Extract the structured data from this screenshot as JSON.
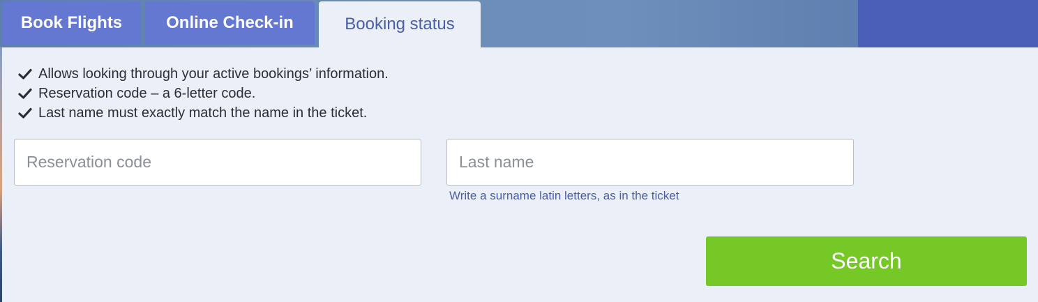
{
  "tabs": [
    {
      "label": "Book Flights",
      "active": false
    },
    {
      "label": "Online Check-in",
      "active": false
    },
    {
      "label": "Booking status",
      "active": true
    }
  ],
  "info": {
    "icon": "checkmark-icon",
    "items": [
      "Allows looking through your active bookings’ information.",
      "Reservation code – a 6-letter code.",
      "Last name must exactly match the name in the ticket."
    ]
  },
  "form": {
    "reservation_placeholder": "Reservation code",
    "reservation_value": "",
    "lastname_placeholder": "Last name",
    "lastname_value": "",
    "lastname_hint": "Write a surname latin letters, as in the ticket",
    "search_label": "Search"
  },
  "colors": {
    "tab_inactive": "#6478d2",
    "tab_active_text": "#4a5da8",
    "panel_bg": "#eaeff8",
    "search_button": "#76c827",
    "hint_text": "#4a5da8"
  }
}
